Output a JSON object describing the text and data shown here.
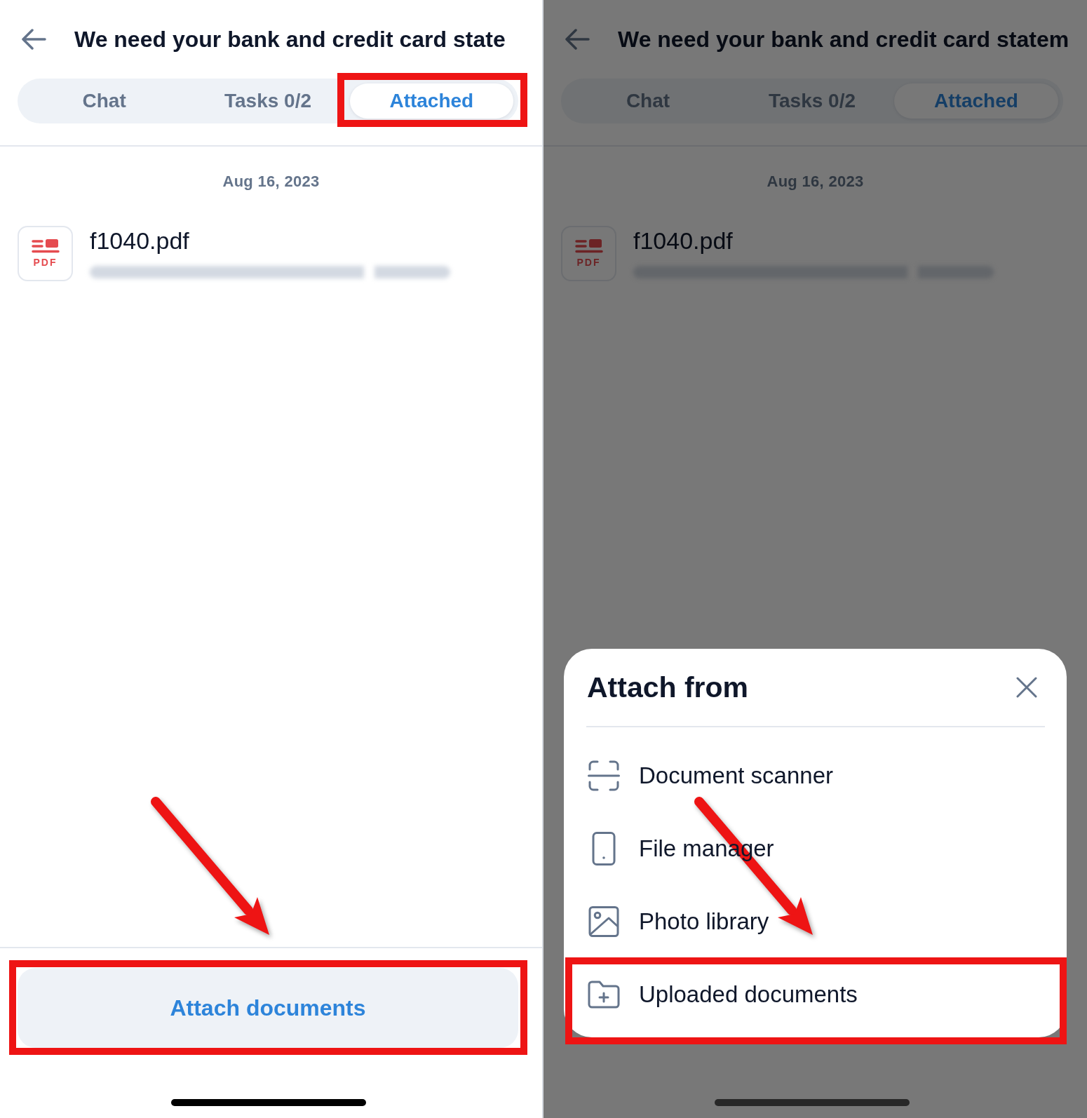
{
  "screens": [
    {
      "dimmed": false,
      "callout_arrow": true,
      "header": {
        "title": "We need your bank and credit card state"
      },
      "tabs": [
        {
          "label": "Chat",
          "selected": false
        },
        {
          "label": "Tasks 0/2",
          "selected": false
        },
        {
          "label": "Attached",
          "selected": true,
          "highlighted": true
        }
      ],
      "date": "Aug 16, 2023",
      "files": [
        {
          "name": "f1040.pdf",
          "type_label": "PDF",
          "redacted_line": true
        }
      ],
      "primary_button": {
        "label": "Attach documents",
        "highlighted": true
      }
    },
    {
      "dimmed": true,
      "callout_arrow": true,
      "header": {
        "title": "We need your bank and credit card statem"
      },
      "tabs": [
        {
          "label": "Chat",
          "selected": false
        },
        {
          "label": "Tasks 0/2",
          "selected": false
        },
        {
          "label": "Attached",
          "selected": true
        }
      ],
      "date": "Aug 16, 2023",
      "files": [
        {
          "name": "f1040.pdf",
          "type_label": "PDF",
          "redacted_line": true
        }
      ],
      "sheet": {
        "title": "Attach from",
        "options": [
          {
            "kind": "scanner",
            "label": "Document scanner"
          },
          {
            "kind": "device",
            "label": "File manager"
          },
          {
            "kind": "photos",
            "label": "Photo library"
          },
          {
            "kind": "uploaded",
            "label": "Uploaded documents",
            "highlighted": true
          }
        ]
      }
    }
  ]
}
